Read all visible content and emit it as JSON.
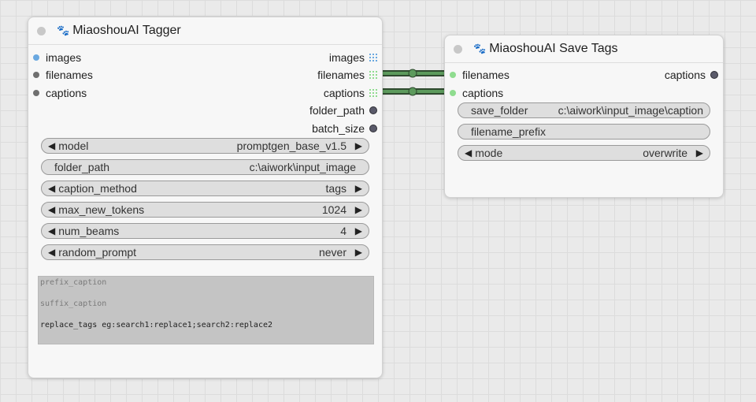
{
  "tagger": {
    "title": "MiaoshouAI Tagger",
    "inputs": [
      "images",
      "filenames",
      "captions"
    ],
    "outputs": [
      "images",
      "filenames",
      "captions",
      "folder_path",
      "batch_size"
    ],
    "widgets": [
      {
        "label": "model",
        "value": "promptgen_base_v1.5"
      },
      {
        "label": "folder_path",
        "value": "c:\\aiwork\\input_image"
      },
      {
        "label": "caption_method",
        "value": "tags"
      },
      {
        "label": "max_new_tokens",
        "value": "1024"
      },
      {
        "label": "num_beams",
        "value": "4"
      },
      {
        "label": "random_prompt",
        "value": "never"
      }
    ],
    "textareas": {
      "prefix_placeholder": "prefix_caption",
      "suffix_placeholder": "suffix_caption",
      "replace_tags_value": "replace_tags eg:search1:replace1;search2:replace2"
    }
  },
  "save_tags": {
    "title": "MiaoshouAI Save Tags",
    "inputs": [
      "filenames",
      "captions"
    ],
    "outputs": [
      "captions"
    ],
    "widgets": [
      {
        "label": "save_folder",
        "value": "c:\\aiwork\\input_image\\caption"
      },
      {
        "label": "filename_prefix",
        "value": ""
      },
      {
        "label": "mode",
        "value": "overwrite"
      }
    ]
  },
  "icons": {
    "collapse": "collapse-dot-icon",
    "node_badge": "paw-icon",
    "arrow_left": "triangle-left-icon",
    "arrow_right": "triangle-right-icon",
    "list_output": "grid-output-icon"
  },
  "colors": {
    "image_slot": "#6aa8e0",
    "string_slot": "#8fdc8f",
    "link": "#4f8f4f",
    "node_bg": "#f7f7f7",
    "widget_bg": "#dedede"
  }
}
